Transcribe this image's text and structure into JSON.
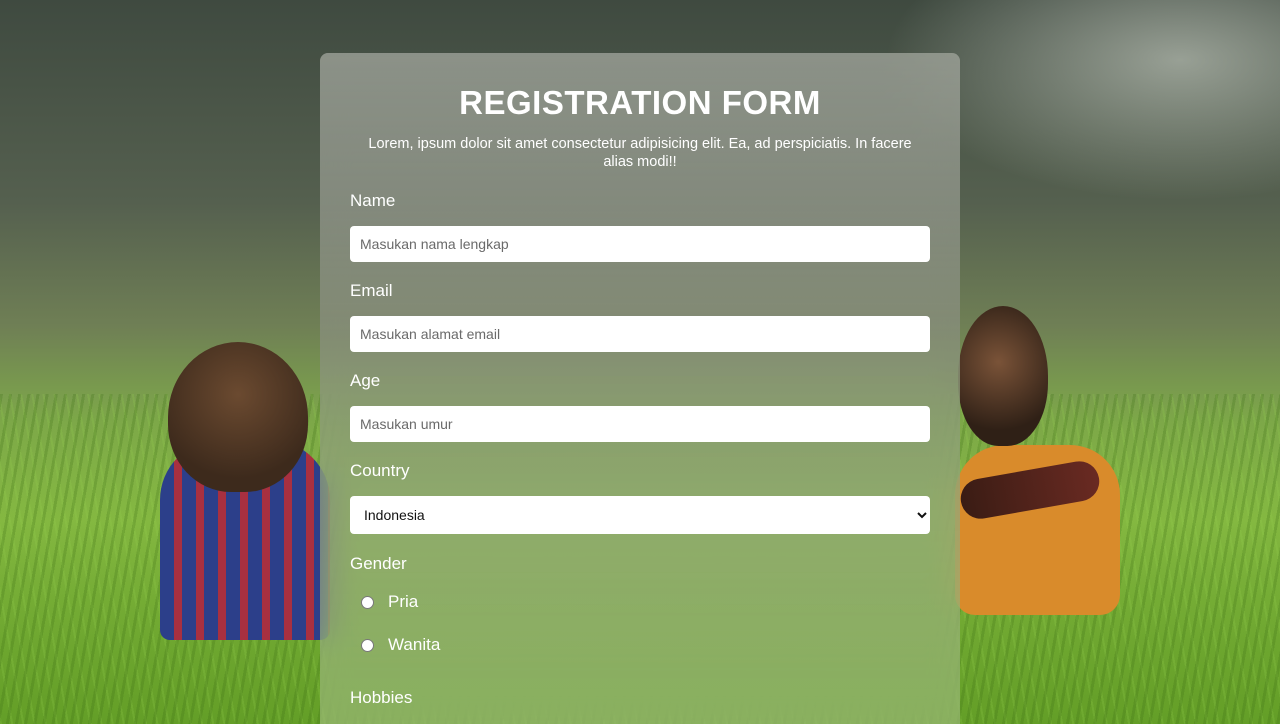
{
  "form": {
    "title": "REGISTRATION FORM",
    "subtitle": "Lorem, ipsum dolor sit amet consectetur adipisicing elit. Ea, ad perspiciatis. In facere alias modi!!",
    "name": {
      "label": "Name",
      "placeholder": "Masukan nama lengkap",
      "value": ""
    },
    "email": {
      "label": "Email",
      "placeholder": "Masukan alamat email",
      "value": ""
    },
    "age": {
      "label": "Age",
      "placeholder": "Masukan umur",
      "value": ""
    },
    "country": {
      "label": "Country",
      "selected": "Indonesia"
    },
    "gender": {
      "label": "Gender",
      "options": [
        "Pria",
        "Wanita"
      ]
    },
    "hobbies": {
      "label": "Hobbies"
    }
  }
}
